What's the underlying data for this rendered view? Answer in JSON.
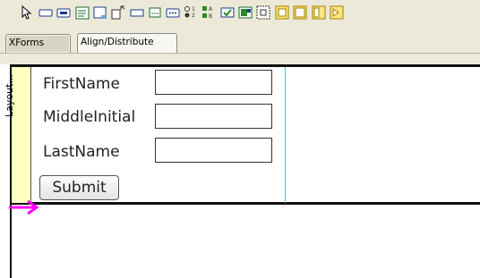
{
  "toolbar": {
    "icons": [
      "select-pointer-icon",
      "input-field-icon",
      "secret-field-icon",
      "textarea-icon",
      "output-field-icon",
      "upload-icon",
      "range-icon",
      "trigger-button-icon",
      "submit-button-icon",
      "select-one-icon",
      "select-many-icon",
      "checkbox-icon",
      "combo-box-icon",
      "group-icon",
      "repeat-icon",
      "switch-icon",
      "case-icon",
      "label-icon"
    ]
  },
  "tabs": [
    {
      "label": "XForms",
      "active": false
    },
    {
      "label": "Align/Distribute",
      "active": true
    }
  ],
  "layout": {
    "label": "Layout...",
    "strip_color": "#ffffc0",
    "guide_color": "#00e5ee",
    "arrow_color": "#ff00ff"
  },
  "form": {
    "fields": [
      {
        "label": "FirstName",
        "value": ""
      },
      {
        "label": "MiddleInitial",
        "value": ""
      },
      {
        "label": "LastName",
        "value": ""
      }
    ],
    "submit_label": "Submit"
  }
}
